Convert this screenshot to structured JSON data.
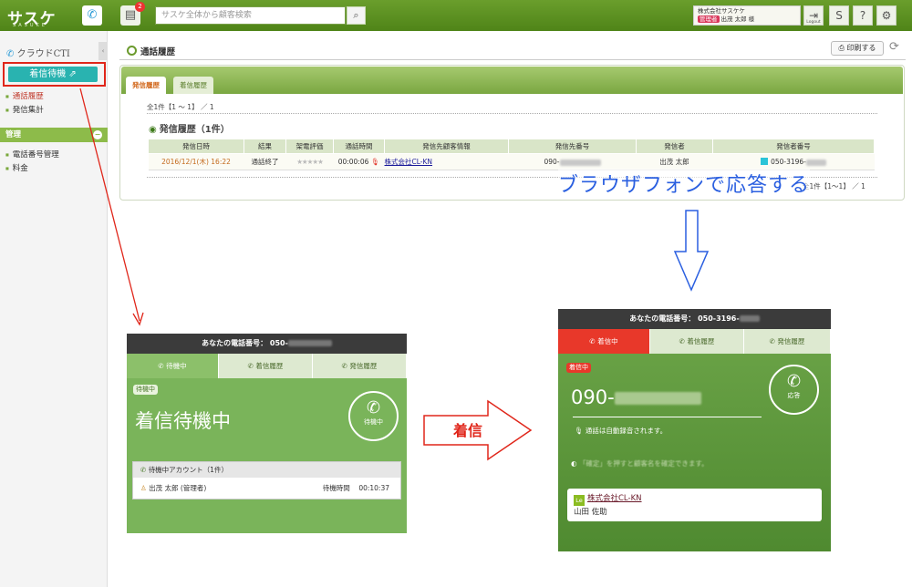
{
  "app": {
    "logo": "サスケ",
    "logo_sub": "SASUKE",
    "notification_count": "2",
    "search_placeholder": "サスケ全体から顧客検索",
    "company": "株式会社サスケケ",
    "role_tag": "管理者",
    "user": "出茂 太郎 様",
    "logout_label": "Logout"
  },
  "sidebar": {
    "cti_title": "クラウドCTI",
    "wait_button": "着信待機",
    "items": [
      {
        "label": "通話履歴"
      },
      {
        "label": "発信集計"
      }
    ],
    "admin_head": "管理",
    "admin_items": [
      {
        "label": "電話番号管理"
      },
      {
        "label": "料金"
      }
    ]
  },
  "main": {
    "title": "通話履歴",
    "print_label": "印刷する",
    "tabs": [
      {
        "label": "発信履歴",
        "active": true
      },
      {
        "label": "着信履歴",
        "active": false
      }
    ],
    "count_text": "全1件【1 ～ 1】 ／ 1",
    "section_title": "発信履歴（1件）",
    "columns": [
      "発信日時",
      "結果",
      "架電評価",
      "通話時間",
      "発信先顧客情報",
      "発信先番号",
      "発信者",
      "発信者番号"
    ],
    "row": {
      "date": "2016/12/1(木) 16:22",
      "result": "通話終了",
      "rating": "★★★★★",
      "duration": "00:00:06",
      "customer": "株式会社CL-KN",
      "dest_number": "090-",
      "caller": "出茂 太郎",
      "caller_number": "050-3196-"
    },
    "pager": "全1件【1～1】 ／ 1"
  },
  "annotation": {
    "browser_phone": "ブラウザフォンで応答する",
    "incoming_arrow": "着信"
  },
  "phone_waiting": {
    "header": "あなたの電話番号： 050-",
    "tabs": [
      "待機中",
      "着信履歴",
      "発信履歴"
    ],
    "status_tag": "待機中",
    "big_text": "着信待機中",
    "circle_label": "待機中",
    "account_head": "待機中アカウント（1件）",
    "account_name": "出茂 太郎 (管理者)",
    "wait_label": "待機時間",
    "wait_time": "00:10:37"
  },
  "phone_incoming": {
    "header": "あなたの電話番号： 050-3196-",
    "tabs": [
      "着信中",
      "着信履歴",
      "発信履歴"
    ],
    "status_tag": "着信中",
    "number": "090-",
    "answer_label": "応答",
    "auto_record": "通話は自動録音されます。",
    "hint": "「確定」を押すと顧客名を確定できます。",
    "customer_company": "株式会社CL-KN",
    "customer_person": "山田 佐助"
  },
  "colors": {
    "brand_green": "#5a8f22",
    "accent_teal": "#29b3b0",
    "highlight_red": "#e0261a",
    "annotation_blue": "#2a5fe0"
  }
}
